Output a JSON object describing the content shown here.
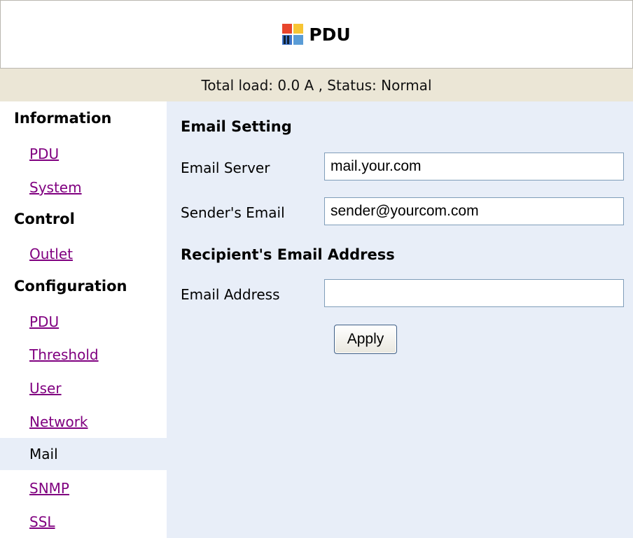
{
  "header": {
    "title": "PDU",
    "logo_icon": "pdu-logo-icon"
  },
  "status": {
    "text": "Total load: 0.0 A , Status: Normal"
  },
  "sidebar": {
    "sections": [
      {
        "label": "Information",
        "items": [
          "PDU",
          "System"
        ]
      },
      {
        "label": "Control",
        "items": [
          "Outlet"
        ]
      },
      {
        "label": "Configuration",
        "items": [
          "PDU",
          "Threshold",
          "User",
          "Network",
          "Mail",
          "SNMP",
          "SSL"
        ]
      }
    ],
    "active_item": "Mail"
  },
  "form": {
    "email_setting_title": "Email Setting",
    "email_server_label": "Email Server",
    "email_server_value": "mail.your.com",
    "sender_label": "Sender's Email",
    "sender_value": "sender@yourcom.com",
    "recipient_title": "Recipient's Email Address",
    "email_address_label": "Email Address",
    "email_address_value": "",
    "apply_label": "Apply"
  },
  "colors": {
    "status_bg": "#ebe6d6",
    "content_bg": "#e8eef8",
    "link": "#800080"
  }
}
